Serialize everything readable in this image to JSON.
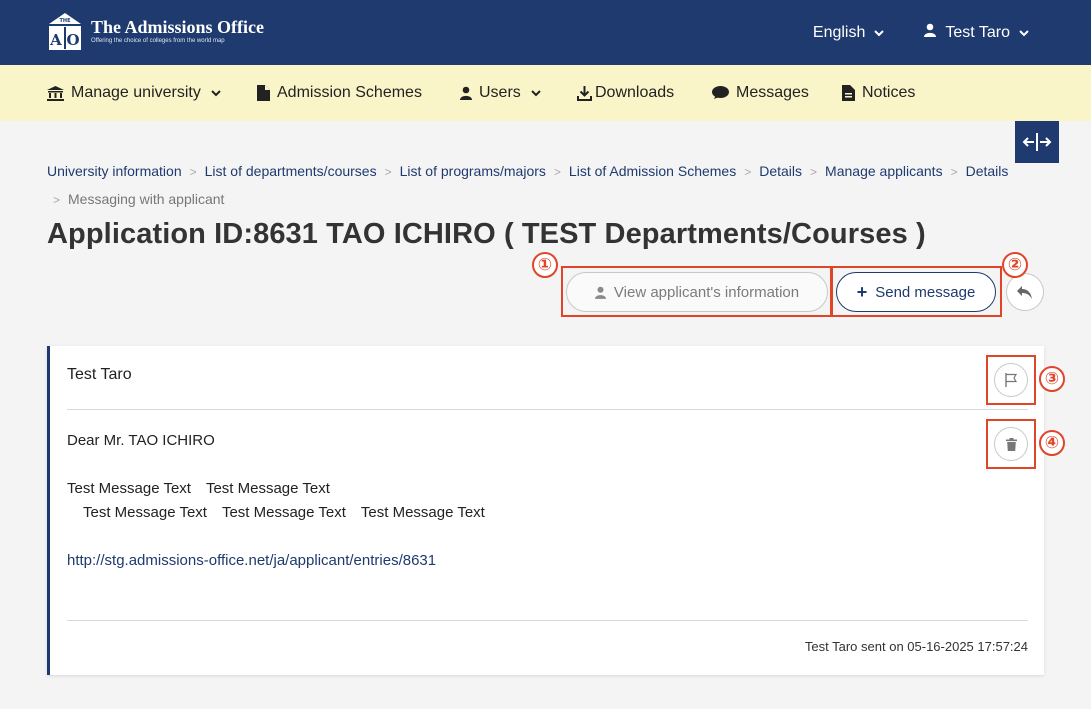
{
  "header": {
    "logo_title": "The Admissions Office",
    "logo_tagline": "Offering the choice of colleges from the world map",
    "logo_mark_text": "TAO",
    "language_label": "English",
    "user_label": "Test Taro"
  },
  "nav": {
    "items": [
      {
        "label": "Manage university",
        "icon": "university-icon"
      },
      {
        "label": "Admission Schemes",
        "icon": "document-icon"
      },
      {
        "label": "Users",
        "icon": "user-icon"
      },
      {
        "label": "Downloads",
        "icon": "download-icon"
      },
      {
        "label": "Messages",
        "icon": "chat-bubble-icon"
      },
      {
        "label": "Notices",
        "icon": "notice-icon"
      }
    ]
  },
  "breadcrumb": {
    "items": [
      "University information",
      "List of departments/courses",
      "List of programs/majors",
      "List of Admission Schemes",
      "Details",
      "Manage applicants",
      "Details"
    ],
    "current": "Messaging with applicant",
    "separator": ">"
  },
  "page": {
    "title": "Application ID:8631 TAO ICHIRO ( TEST Departments/Courses )"
  },
  "actions": {
    "view_label": "View applicant's information",
    "send_label": "Send message",
    "send_icon": "+"
  },
  "annotations": [
    "①",
    "②",
    "③",
    "④"
  ],
  "message": {
    "sender": "Test Taro",
    "greeting": "Dear Mr. TAO ICHIRO",
    "body_line1": [
      "Test Message Text",
      "Test Message Text"
    ],
    "body_line2": [
      "Test Message Text",
      "Test Message Text",
      "Test Message Text"
    ],
    "link": "http://stg.admissions-office.net/ja/applicant/entries/8631",
    "footer": "Test Taro sent on 05-16-2025 17:57:24"
  },
  "colors": {
    "navy": "#1e3a6e",
    "nav_bg": "#f9f5c9",
    "highlight": "#e0452a",
    "page_bg": "#f4f4f4"
  }
}
